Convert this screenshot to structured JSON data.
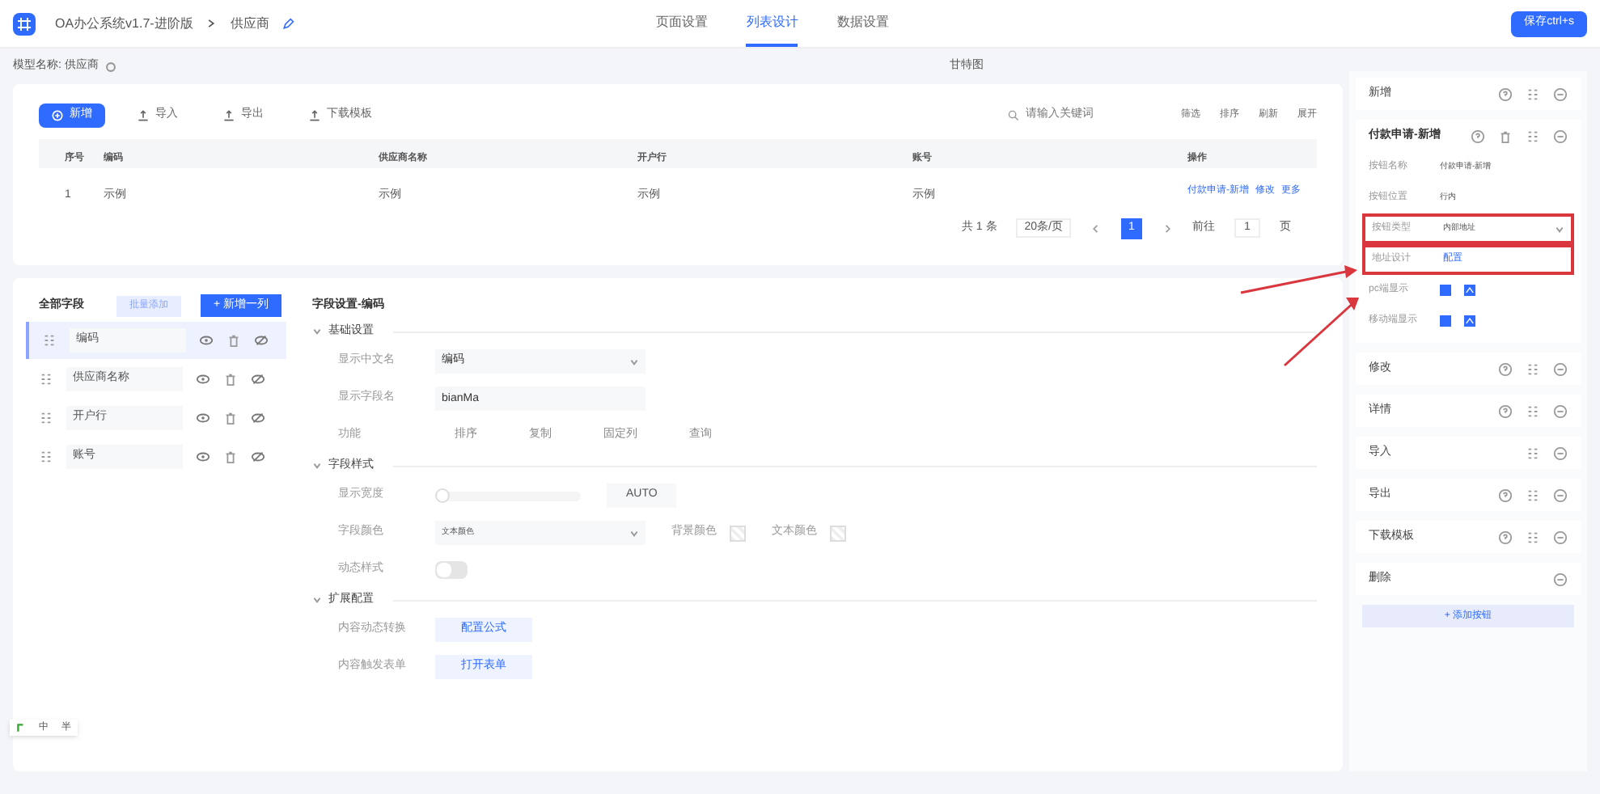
{
  "header": {
    "app": "OA办公系统v1.7-进阶版",
    "crumb": "供应商",
    "tabs": [
      {
        "label": "页面设置",
        "selected": false
      },
      {
        "label": "列表设计",
        "selected": true
      },
      {
        "label": "数据设置",
        "selected": false
      }
    ],
    "save": "保存ctrl+s"
  },
  "model": {
    "label": "模型名称: 供应商",
    "views": [
      "甘特图"
    ]
  },
  "toolbar": {
    "buttons": [
      {
        "label": "新增",
        "kind": "primary"
      },
      {
        "label": "导入",
        "kind": "plain"
      },
      {
        "label": "导出",
        "kind": "plain"
      },
      {
        "label": "下载模板",
        "kind": "plain"
      }
    ],
    "search_placeholder": "请输入关键词",
    "actions": [
      "筛选",
      "排序",
      "刷新",
      "展开"
    ]
  },
  "table": {
    "columns": [
      "序号",
      "编码",
      "供应商名称",
      "开户行",
      "账号",
      "操作"
    ],
    "rows": [
      {
        "cells": [
          "1",
          "示例",
          "示例",
          "示例",
          "示例"
        ],
        "links": [
          "付款申请-新增",
          "修改",
          "更多"
        ]
      }
    ]
  },
  "pagination": {
    "total": "共 1 条",
    "size": "20条/页",
    "pages": [
      {
        "label": "1",
        "selected": true
      }
    ],
    "goto": "前往",
    "goto_value": "1",
    "unit": "页"
  },
  "fields": {
    "title": "全部字段",
    "batch": "批量添加",
    "add": "+ 新增一列",
    "items": [
      {
        "name": "编码",
        "selected": true
      },
      {
        "name": "供应商名称",
        "selected": false
      },
      {
        "name": "开户行",
        "selected": false
      },
      {
        "name": "账号",
        "selected": false
      }
    ]
  },
  "settings": {
    "title": "字段设置-编码",
    "sections": [
      {
        "title": "基础设置",
        "expanded": true,
        "rows": [
          {
            "kind": "select",
            "label": "显示中文名",
            "value": "编码"
          },
          {
            "kind": "input",
            "label": "显示字段名",
            "value": "bianMa"
          },
          {
            "kind": "options",
            "label": "功能",
            "options": [
              "排序",
              "复制",
              "固定列",
              "查询"
            ]
          }
        ]
      },
      {
        "title": "字段样式",
        "expanded": true,
        "rows": [
          {
            "kind": "slider",
            "label": "显示宽度",
            "level": 0,
            "value": "AUTO"
          },
          {
            "kind": "color",
            "label": "字段颜色",
            "value": "文本颜色",
            "extra": [
              "背景颜色",
              "文本颜色"
            ]
          },
          {
            "kind": "toggle",
            "label": "动态样式",
            "on": false
          }
        ]
      },
      {
        "title": "扩展配置",
        "expanded": true,
        "rows": [
          {
            "kind": "button",
            "label": "内容动态转换",
            "value": "配置公式"
          },
          {
            "kind": "button",
            "label": "内容触发表单",
            "value": "打开表单"
          }
        ]
      }
    ]
  },
  "buttons_panel": {
    "items": [
      {
        "label": "新增",
        "expanded": false,
        "help": true,
        "delete": false,
        "sort": true
      },
      {
        "label": "付款申请-新增",
        "expanded": true,
        "help": true,
        "delete": true,
        "sort": true,
        "props": [
          {
            "kind": "text",
            "label": "按钮名称",
            "value": "付款申请-新增"
          },
          {
            "kind": "text",
            "label": "按钮位置",
            "value": "行内"
          },
          {
            "kind": "select",
            "label": "按钮类型",
            "value": "内部地址",
            "highlighted": true
          },
          {
            "kind": "link",
            "label": "地址设计",
            "value": "配置",
            "highlighted": true
          },
          {
            "kind": "check",
            "label": "pc端显示",
            "checked": true
          },
          {
            "kind": "check",
            "label": "移动端显示",
            "checked": true
          }
        ]
      },
      {
        "label": "修改",
        "expanded": false,
        "help": true,
        "delete": false,
        "sort": true
      },
      {
        "label": "详情",
        "expanded": false,
        "help": true,
        "delete": false,
        "sort": true
      },
      {
        "label": "导入",
        "expanded": false,
        "help": false,
        "delete": false,
        "sort": true
      },
      {
        "label": "导出",
        "expanded": false,
        "help": true,
        "delete": false,
        "sort": true
      },
      {
        "label": "下载模板",
        "expanded": false,
        "help": true,
        "delete": false,
        "sort": true
      },
      {
        "label": "删除",
        "expanded": false,
        "help": false,
        "delete": false,
        "sort": false
      }
    ],
    "add": "+ 添加按钮"
  },
  "ime_bar": [
    "中",
    "半"
  ]
}
